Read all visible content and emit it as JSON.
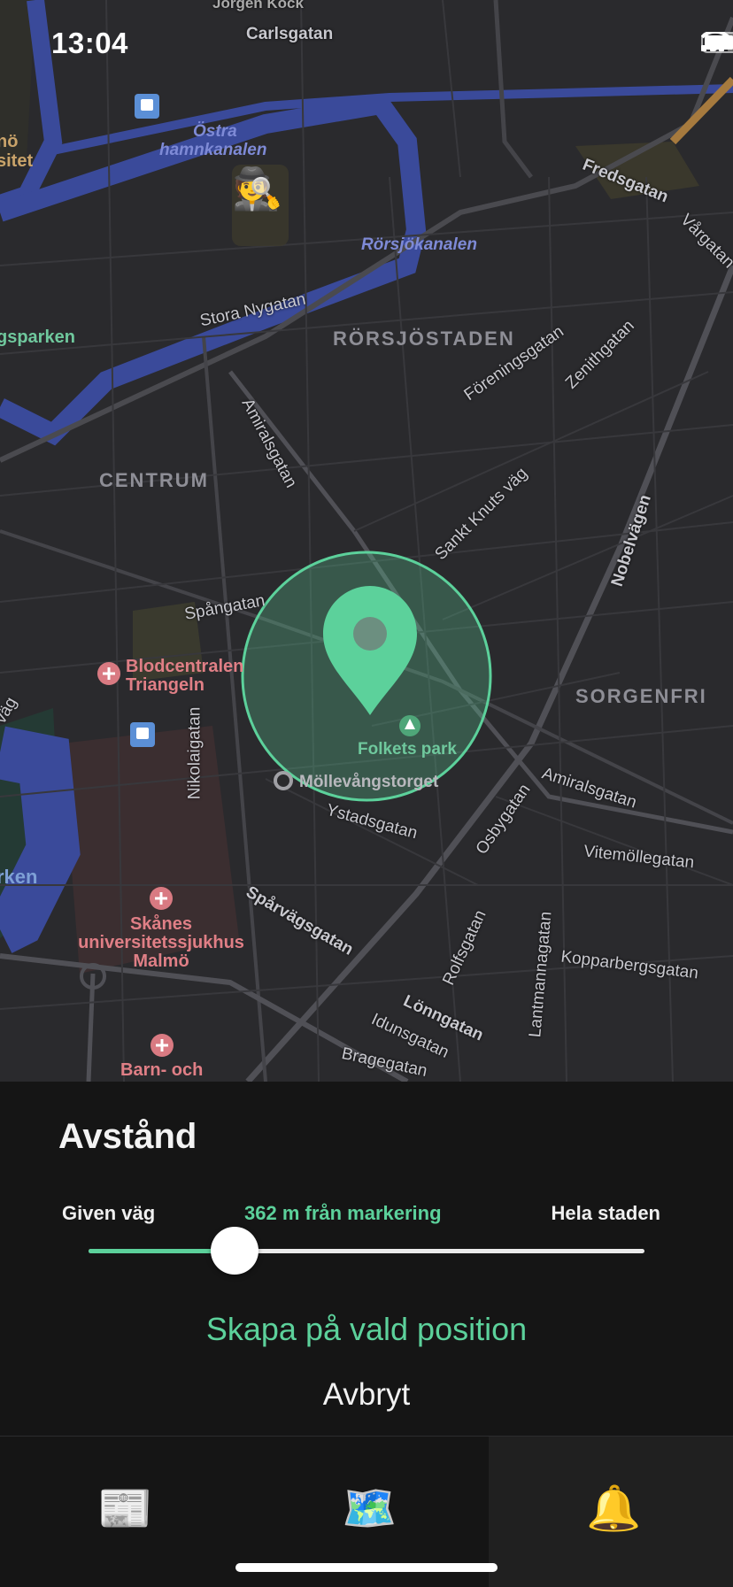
{
  "status_bar": {
    "time": "13:04"
  },
  "map": {
    "street_labels": [
      "Jörgen Kock",
      "Carlsgatan",
      "Fredsgatan",
      "Vårgatan",
      "Stora Nygatan",
      "Föreningsgatan",
      "Zenithgatan",
      "Amiralsgatan",
      "Sankt Knuts väg",
      "Nobelvägen",
      "Spångatan",
      "Nikolaigatan",
      "Ystadsgatan",
      "Osbygatan",
      "Amiralsgatan",
      "Vitemöllegatan",
      "Spårvägsgatan",
      "Rolfsgatan",
      "Lantmannagatan",
      "Kopparbergsgatan",
      "Lönngatan",
      "Idunsgatan",
      "Bragegatan",
      "väg"
    ],
    "water_labels": [
      "Östra",
      "hamnkanalen",
      "Rörsjökanalen"
    ],
    "district_labels": [
      "RÖRSJÖSTADEN",
      "CENTRUM",
      "SORGENFRI"
    ],
    "park_labels": [
      "gsparken",
      "rken"
    ],
    "edge_labels": [
      "nö",
      "sitet"
    ],
    "pois": {
      "blodcentralen": "Blodcentralen Triangeln",
      "skanes": "Skånes universitetssjukhus Malmö",
      "barn": "Barn- och",
      "folkets_park": "Folkets park",
      "mollevangstorget": "Möllevångstorget"
    },
    "marker_emoji": "🕵️",
    "pin_icon": "map-pin-icon",
    "accent_color": "#5cd19b"
  },
  "sheet": {
    "title": "Avstånd",
    "left_label": "Given väg",
    "value_label": "362 m från markering",
    "right_label": "Hela staden",
    "slider_fraction": 0.263,
    "primary_button": "Skapa på vald position",
    "cancel_button": "Avbryt"
  },
  "tabs": [
    {
      "emoji": "📰",
      "icon": "newspaper-icon",
      "active": false
    },
    {
      "emoji": "🗺️",
      "icon": "world-map-icon",
      "active": false
    },
    {
      "emoji": "🔔",
      "icon": "bell-icon",
      "active": true
    }
  ]
}
